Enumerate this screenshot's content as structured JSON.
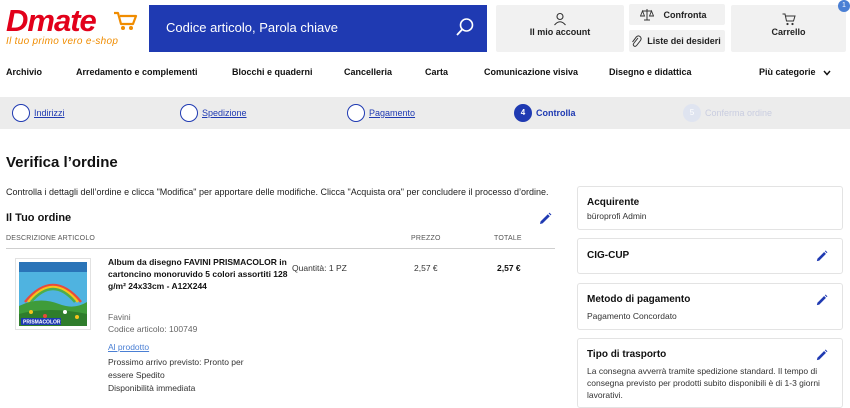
{
  "header": {
    "logo": "Dmate",
    "tagline": "Il tuo primo vero e-shop",
    "search_placeholder": "Codice articolo, Parola chiave",
    "account_label": "Il mio account",
    "compare_label": "Confronta",
    "wishlist_label": "Liste dei desideri",
    "cart_label": "Carrello",
    "cart_count": "1"
  },
  "categories": {
    "items": [
      "Archivio",
      "Arredamento e complementi",
      "Blocchi e quaderni",
      "Cancelleria",
      "Carta",
      "Comunicazione visiva",
      "Disegno e didattica"
    ],
    "more": "Più categorie"
  },
  "steps": [
    {
      "label": "Indirizzi",
      "state": "done"
    },
    {
      "label": "Spedizione",
      "state": "done"
    },
    {
      "label": "Pagamento",
      "state": "done"
    },
    {
      "number": "4",
      "label": "Controlla",
      "state": "active"
    },
    {
      "number": "5",
      "label": "Conferma ordine",
      "state": "disabled"
    }
  ],
  "main": {
    "title": "Verifica l’ordine",
    "intro": "Controlla i dettagli dell’ordine e clicca \"Modifica\" per apportare delle modifiche. Clicca \"Acquista ora\" per concludere il processo d’ordine.",
    "order_title": "Il Tuo ordine",
    "columns": {
      "description": "DESCRIZIONE ARTICOLO",
      "price": "PREZZO",
      "total": "TOTALE"
    }
  },
  "product": {
    "name": "Album da disegno FAVINI PRISMACOLOR in cartoncino monoruvido 5 colori assortiti 128 g/m² 24x33cm - A12X244",
    "brand": "Favini",
    "code": "Codice articolo: 100749",
    "link": "Al prodotto",
    "arrival": "Prossimo arrivo previsto: Pronto per essere Spedito",
    "availability": "Disponibilità immediata",
    "quantity": "Quantità: 1  PZ",
    "price": "2,57 €",
    "total": "2,57 €",
    "image_text": "PRISMACOLOR"
  },
  "sidebar": {
    "buyer_title": "Acquirente",
    "buyer_value": "büroprofi Admin",
    "cig_title": "CIG-CUP",
    "payment_title": "Metodo di pagamento",
    "payment_value": "Pagamento Concordato",
    "shipping_title": "Tipo di trasporto",
    "shipping_value": "La consegna avverrà tramite spedizione standard. Il tempo di consegna previsto per prodotti subito disponibili è di 1-3 giorni lavorativi."
  },
  "colors": {
    "brand_blue": "#1f3ab2",
    "logo_red": "#e2001a",
    "tagline_orange": "#f08c00",
    "link_blue": "#4a7fd4"
  }
}
